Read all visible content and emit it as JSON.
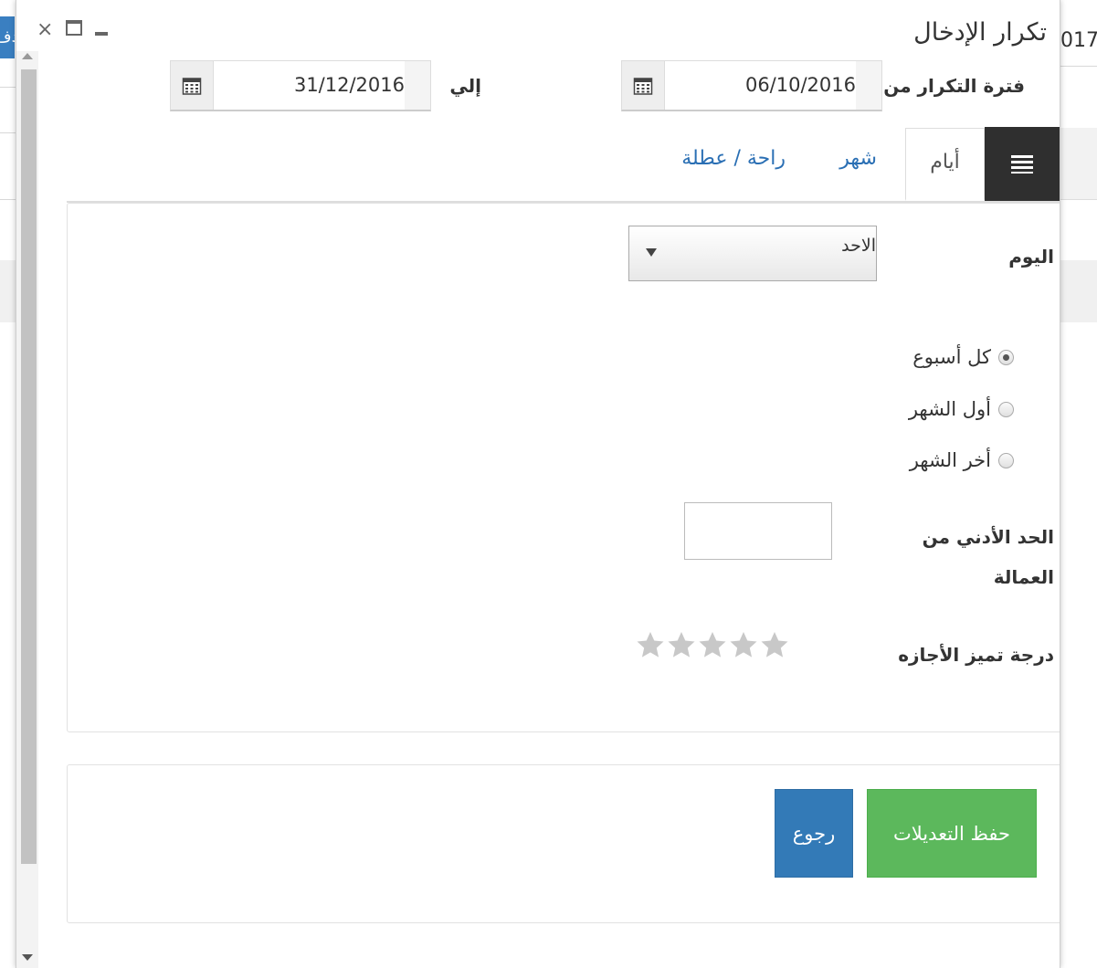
{
  "background": {
    "left_button_text": "دف",
    "right_year_text": "017"
  },
  "dialog": {
    "title": "تكرار الإدخال",
    "window_buttons": {
      "close": "×"
    }
  },
  "period": {
    "from_label": "فترة التكرار من",
    "from_value": "06/10/2016",
    "to_label": "إلي",
    "to_value": "31/12/2016"
  },
  "tabs": [
    {
      "label": "أيام",
      "active": true
    },
    {
      "label": "شهر",
      "active": false
    },
    {
      "label": "راحة / عطلة",
      "active": false
    }
  ],
  "form": {
    "day_label": "اليوم",
    "day_selected": "الاحد",
    "frequency_options": [
      {
        "label": "كل أسبوع",
        "checked": true
      },
      {
        "label": "أول الشهر",
        "checked": false
      },
      {
        "label": "أخر الشهر",
        "checked": false
      }
    ],
    "min_workers_label_line1": "الحد الأدني من",
    "min_workers_label_line2": "العمالة",
    "min_workers_value": "",
    "rating_label": "درجة تميز الأجازه",
    "rating_value": 0,
    "rating_max": 5,
    "star_color": "#c8c8c8"
  },
  "actions": {
    "save_label": "حفظ التعديلات",
    "back_label": "رجوع",
    "save_color": "#5cb85c",
    "back_color": "#337ab7"
  }
}
